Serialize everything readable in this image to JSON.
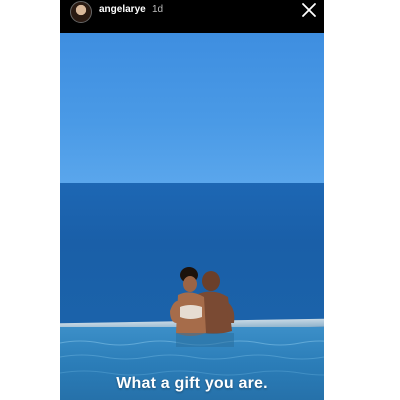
{
  "story": {
    "username": "angelarye",
    "timestamp": "1d",
    "caption": "What a gift you are."
  },
  "icons": {
    "close": "close-icon",
    "avatar": "profile-avatar"
  },
  "colors": {
    "header_bg": "#000000",
    "sky": "#4a9ae6",
    "sea": "#1a5fa8",
    "pool": "#2b7db8",
    "caption_text": "#ffffff"
  }
}
